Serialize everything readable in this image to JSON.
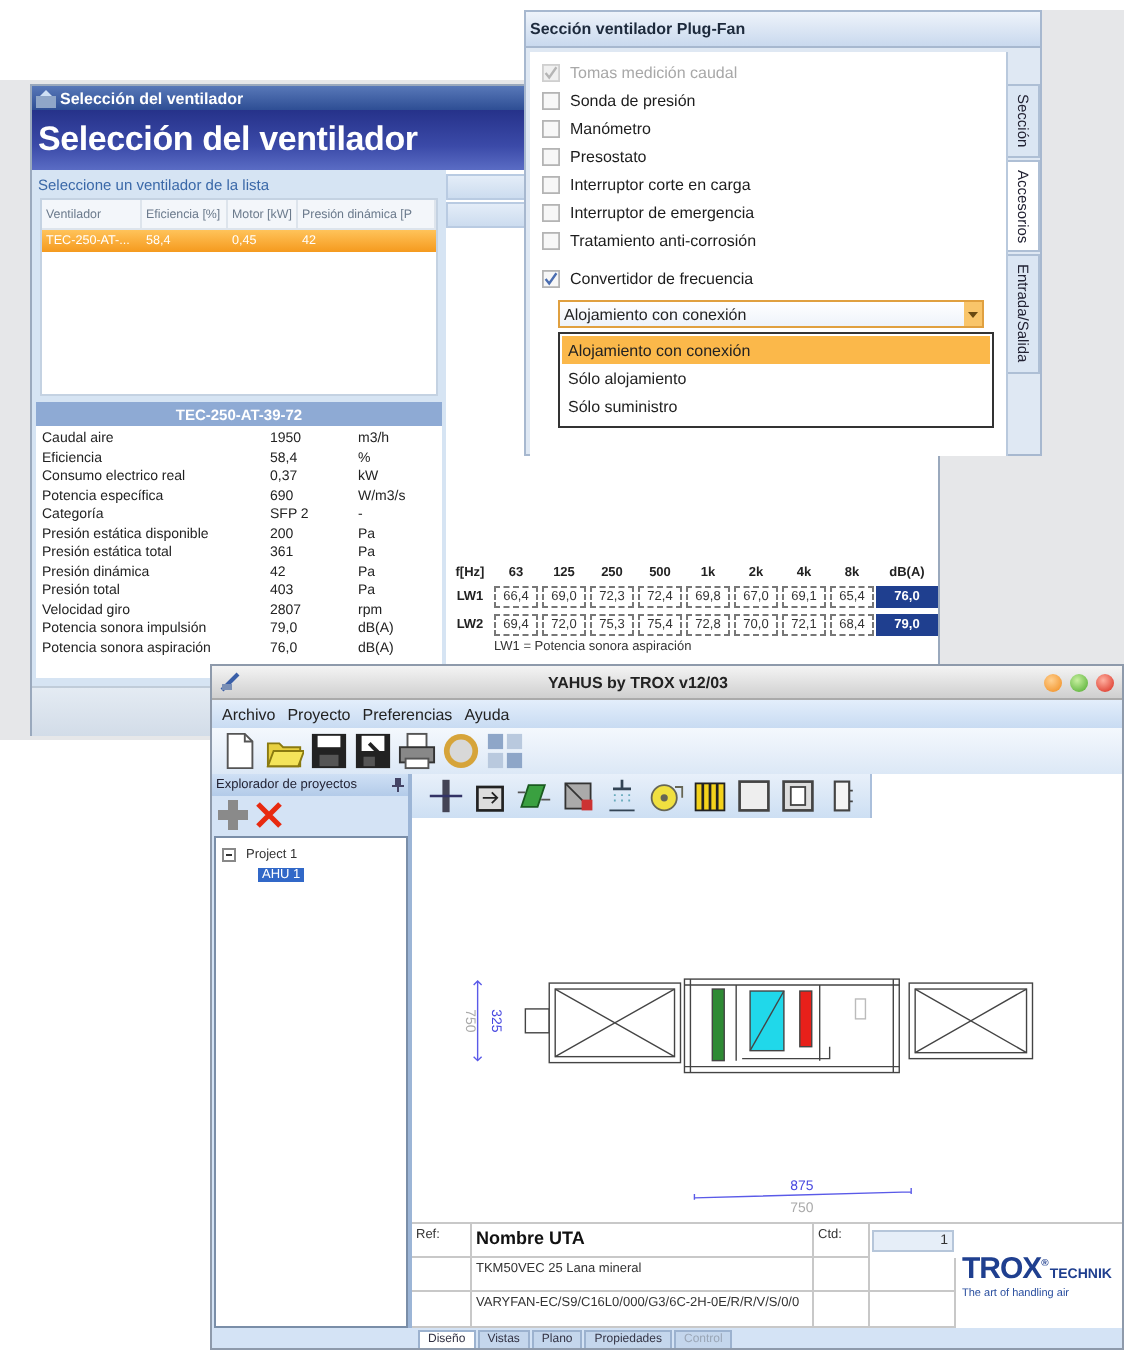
{
  "selection_window": {
    "title": "Selección del ventilador",
    "header": "Selección del ventilador",
    "list_caption": "Seleccione un ventilador de la lista",
    "columns": [
      "Ventilador",
      "Eficiencia [%]",
      "Motor [kW]",
      "Presión dinámica [P"
    ],
    "rows": [
      {
        "cells": [
          "TEC-250-AT-...",
          "58,4",
          "0,45",
          "42"
        ],
        "selected": true
      }
    ],
    "detail_title": "TEC-250-AT-39-72",
    "details": [
      {
        "label": "Caudal aire",
        "value": "1950",
        "unit": "m3/h"
      },
      {
        "label": "Eficiencia",
        "value": "58,4",
        "unit": "%"
      },
      {
        "label": "Consumo electrico real",
        "value": "0,37",
        "unit": "kW"
      },
      {
        "label": "Potencia específica",
        "value": "690",
        "unit": "W/m3/s"
      },
      {
        "label": "Categoría",
        "value": "SFP 2",
        "unit": "-"
      },
      {
        "label": "Presión estática disponible",
        "value": "200",
        "unit": "Pa"
      },
      {
        "label": "Presión estática total",
        "value": "361",
        "unit": "Pa"
      },
      {
        "label": "Presión dinámica",
        "value": "42",
        "unit": "Pa"
      },
      {
        "label": "Presión total",
        "value": "403",
        "unit": "Pa"
      },
      {
        "label": "Velocidad giro",
        "value": "2807",
        "unit": "rpm"
      },
      {
        "label": "Potencia sonora impulsión",
        "value": "79,0",
        "unit": "dB(A)"
      },
      {
        "label": "Potencia sonora aspiración",
        "value": "76,0",
        "unit": "dB(A)"
      }
    ],
    "sound": {
      "columns": [
        "f[Hz]",
        "63",
        "125",
        "250",
        "500",
        "1k",
        "2k",
        "4k",
        "8k",
        "dB(A)"
      ],
      "rows": [
        {
          "label": "LW1",
          "values": [
            "66,4",
            "69,0",
            "72,3",
            "72,4",
            "69,8",
            "67,0",
            "69,1",
            "65,4"
          ],
          "total": "76,0"
        },
        {
          "label": "LW2",
          "values": [
            "69,4",
            "72,0",
            "75,3",
            "75,4",
            "72,8",
            "70,0",
            "72,1",
            "68,4"
          ],
          "total": "79,0"
        }
      ],
      "note": "LW1 = Potencia sonora aspiración"
    }
  },
  "plugfan_window": {
    "title": "Sección ventilador Plug-Fan",
    "options": [
      {
        "label": "Tomas medición caudal",
        "checked": true,
        "disabled": true
      },
      {
        "label": "Sonda de presión",
        "checked": false,
        "disabled": false
      },
      {
        "label": "Manómetro",
        "checked": false,
        "disabled": false
      },
      {
        "label": "Presostato",
        "checked": false,
        "disabled": false
      },
      {
        "label": "Interruptor corte en carga",
        "checked": false,
        "disabled": false
      },
      {
        "label": "Interruptor de emergencia",
        "checked": false,
        "disabled": false
      },
      {
        "label": "Tratamiento anti-corrosión",
        "checked": false,
        "disabled": false
      }
    ],
    "converter": {
      "label": "Convertidor de frecuencia",
      "checked": true
    },
    "combo": {
      "value": "Alojamiento con conexión",
      "expanded": true,
      "options": [
        {
          "label": "Alojamiento con conexión",
          "selected": true
        },
        {
          "label": "Sólo alojamiento",
          "selected": false
        },
        {
          "label": "Sólo suministro",
          "selected": false
        }
      ]
    },
    "side_tabs": [
      {
        "label": "Sección",
        "selected": false
      },
      {
        "label": "Accesorios",
        "selected": true
      },
      {
        "label": "Entrada/Salida",
        "selected": false
      }
    ]
  },
  "yahus_window": {
    "title": "YAHUS by TROX v12/03",
    "menu": [
      "Archivo",
      "Proyecto",
      "Preferencias",
      "Ayuda"
    ],
    "explorer": {
      "title": "Explorador de proyectos",
      "tree": [
        {
          "label": "Project 1",
          "expanded": true,
          "selected": false,
          "children": [
            {
              "label": "AHU 1",
              "selected": true
            }
          ]
        }
      ]
    },
    "drawing": {
      "vertical_dimension": [
        "325",
        "750"
      ],
      "horizontal_dimension": [
        "875",
        "750"
      ]
    },
    "title_block": {
      "ref_label": "Ref:",
      "name": "Nombre UTA",
      "qty_label": "Ctd:",
      "qty": "1",
      "lines": [
        "TKM50VEC 25 Lana mineral",
        "VARYFAN-EC/S9/C16L0/000/G3/6C-2H-0E/R/R/V/S/0/0"
      ]
    },
    "logo": {
      "brand": "TROX$^{®}$",
      "suffix": "TECHNIK",
      "tagline": "The art of handling air"
    },
    "tabs": [
      {
        "label": "Diseño",
        "selected": true,
        "disabled": false
      },
      {
        "label": "Vistas",
        "selected": false,
        "disabled": false
      },
      {
        "label": "Plano",
        "selected": false,
        "disabled": false
      },
      {
        "label": "Propiedades",
        "selected": false,
        "disabled": false
      },
      {
        "label": "Control",
        "selected": false,
        "disabled": true
      }
    ]
  }
}
